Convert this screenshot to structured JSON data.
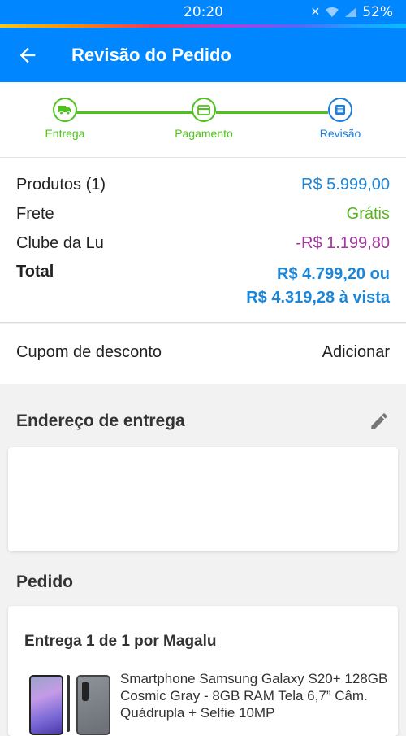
{
  "status_bar": {
    "time": "20:20",
    "battery": "52%"
  },
  "app_bar": {
    "title": "Revisão do Pedido"
  },
  "stepper": {
    "steps": [
      {
        "label": "Entrega",
        "icon": "truck-icon"
      },
      {
        "label": "Pagamento",
        "icon": "card-icon"
      },
      {
        "label": "Revisão",
        "icon": "list-icon"
      }
    ],
    "active_index": 2
  },
  "summary": {
    "products_label": "Produtos (1)",
    "products_value": "R$ 5.999,00",
    "shipping_label": "Frete",
    "shipping_value": "Grátis",
    "club_label": "Clube da Lu",
    "club_value": "-R$ 1.199,80",
    "total_label": "Total",
    "total_value_line1": "R$ 4.799,20 ou",
    "total_value_line2": "R$ 4.319,28 à vista"
  },
  "coupon": {
    "label": "Cupom de desconto",
    "action": "Adicionar"
  },
  "address": {
    "title": "Endereço de entrega"
  },
  "order": {
    "title": "Pedido",
    "delivery": "Entrega 1 de 1 por Magalu",
    "product_name": "Smartphone Samsung Galaxy S20+ 128GB Cosmic Gray - 8GB RAM Tela 6,7” Câm. Quádrupla + Selfie 10MP"
  },
  "colors": {
    "primary": "#0086ff",
    "success": "#4fc31b",
    "price_blue": "#1c86d8",
    "discount_purple": "#a3379f"
  }
}
